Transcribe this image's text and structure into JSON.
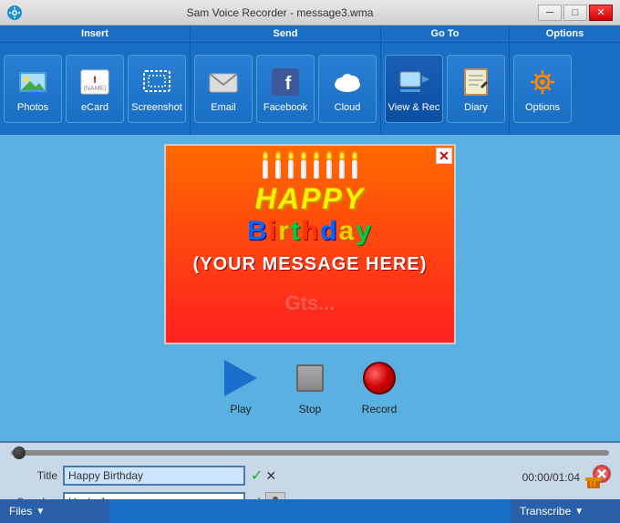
{
  "titleBar": {
    "title": "Sam Voice Recorder - message3.wma",
    "minBtn": "─",
    "maxBtn": "□",
    "closeBtn": "✕",
    "appIconLabel": "S"
  },
  "toolbar": {
    "groups": [
      {
        "label": "Insert",
        "buttons": [
          {
            "id": "photos",
            "label": "Photos"
          },
          {
            "id": "ecard",
            "label": "eCard"
          },
          {
            "id": "screenshot",
            "label": "Screenshot"
          }
        ]
      },
      {
        "label": "Send",
        "buttons": [
          {
            "id": "email",
            "label": "Email"
          },
          {
            "id": "facebook",
            "label": "Facebook"
          },
          {
            "id": "cloud",
            "label": "Cloud"
          }
        ]
      },
      {
        "label": "Go To",
        "buttons": [
          {
            "id": "viewrec",
            "label": "View & Rec"
          },
          {
            "id": "diary",
            "label": "Diary"
          }
        ]
      },
      {
        "label": "Options",
        "buttons": [
          {
            "id": "options",
            "label": "Options"
          }
        ]
      }
    ]
  },
  "card": {
    "happyText": "Happy",
    "birthdayText": "Birthday",
    "messageText": "(YOUR MESSAGE HERE)"
  },
  "controls": {
    "play": "Play",
    "stop": "Stop",
    "record": "Record"
  },
  "bottomPanel": {
    "titleLabel": "Title",
    "titleValue": "Happy Birthday",
    "speakerLabel": "Speaker",
    "speakerValue": "Uncle Joe",
    "timeDisplay": "00:00/01:04"
  },
  "statusBar": {
    "leftLabel": "Files",
    "rightLabel": "Transcribe"
  }
}
